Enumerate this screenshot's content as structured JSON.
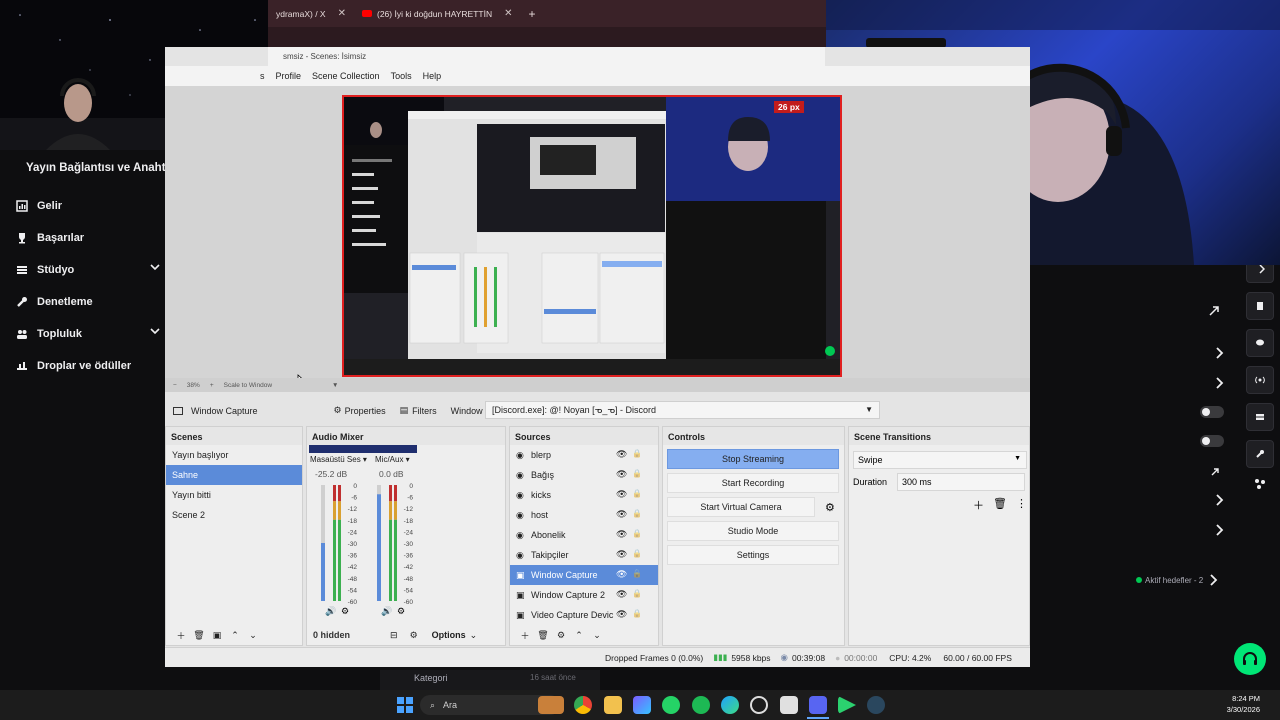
{
  "dashboard": {
    "title": "Yayın Bağlantısı ve Anahtarı",
    "nav": [
      {
        "label": "Gelir",
        "icon": "chart-icon"
      },
      {
        "label": "Başarılar",
        "icon": "trophy-icon"
      },
      {
        "label": "Stüdyo",
        "icon": "studio-icon",
        "expandable": true
      },
      {
        "label": "Denetleme",
        "icon": "wrench-icon"
      },
      {
        "label": "Topluluk",
        "icon": "community-icon",
        "expandable": true
      },
      {
        "label": "Droplar ve ödüller",
        "icon": "drops-icon"
      }
    ],
    "aktif_hedefler": "Aktif hedefler - 2",
    "kategori": "Kategori",
    "time_ago": "16 saat önce"
  },
  "browser": {
    "tabs": [
      {
        "label": "ydramaX) / X"
      },
      {
        "label": "(26) İyi ki doğdun HAYRETTİN"
      }
    ],
    "new_tab": "+"
  },
  "obs": {
    "title": "smsiz - Scenes: İsimsiz",
    "menu": [
      "s",
      "Profile",
      "Scene Collection",
      "Tools",
      "Help"
    ],
    "preview": {
      "px_label": "26 px",
      "zoom": "38%",
      "scale_mode": "Scale to Window"
    },
    "source_bar": {
      "source_name": "Window Capture",
      "properties": "Properties",
      "filters": "Filters",
      "window_label": "Window",
      "window_value": "[Discord.exe]: @! Noyan [ᓀ_ᓀ] - Discord"
    },
    "scenes": {
      "title": "Scenes",
      "items": [
        "Yayın başlıyor",
        "Sahne",
        "Yayın bitti",
        "Scene 2"
      ],
      "selected_index": 1
    },
    "audio_mixer": {
      "title": "Audio Mixer",
      "channels": [
        {
          "name": "Masaüstü Ses",
          "db": "-25.2 dB",
          "level": 0.5
        },
        {
          "name": "Mic/Aux",
          "db": "0.0 dB",
          "level": 0.92
        }
      ],
      "scale": [
        "0",
        "-6",
        "-12",
        "-18",
        "-24",
        "-30",
        "-36",
        "-42",
        "-48",
        "-54",
        "-60"
      ],
      "hidden": "0 hidden",
      "options": "Options"
    },
    "sources": {
      "title": "Sources",
      "items": [
        "blerp",
        "Bağış",
        "kicks",
        "host",
        "Abonelik",
        "Takipçiler",
        "Window Capture",
        "Window Capture 2",
        "Video Capture Devic"
      ],
      "selected_index": 6
    },
    "controls": {
      "title": "Controls",
      "buttons": [
        "Stop Streaming",
        "Start Recording",
        "Start Virtual Camera",
        "Studio Mode",
        "Settings"
      ]
    },
    "transitions": {
      "title": "Scene Transitions",
      "type": "Swipe",
      "duration_label": "Duration",
      "duration_value": "300 ms"
    },
    "status": {
      "dropped": "Dropped Frames 0 (0.0%)",
      "kbps": "5958 kbps",
      "stream_time": "00:39:08",
      "rec_time": "00:00:00",
      "cpu": "CPU: 4.2%",
      "fps": "60.00 / 60.00 FPS"
    }
  },
  "taskbar": {
    "search": "Ara",
    "time": "8:24 PM",
    "date": "3/30/2026"
  },
  "colors": {
    "accent_blue": "#5b8bd9",
    "stream_button": "#85aef0",
    "red_border": "#e02020",
    "dash_bg": "#0e0e10"
  }
}
